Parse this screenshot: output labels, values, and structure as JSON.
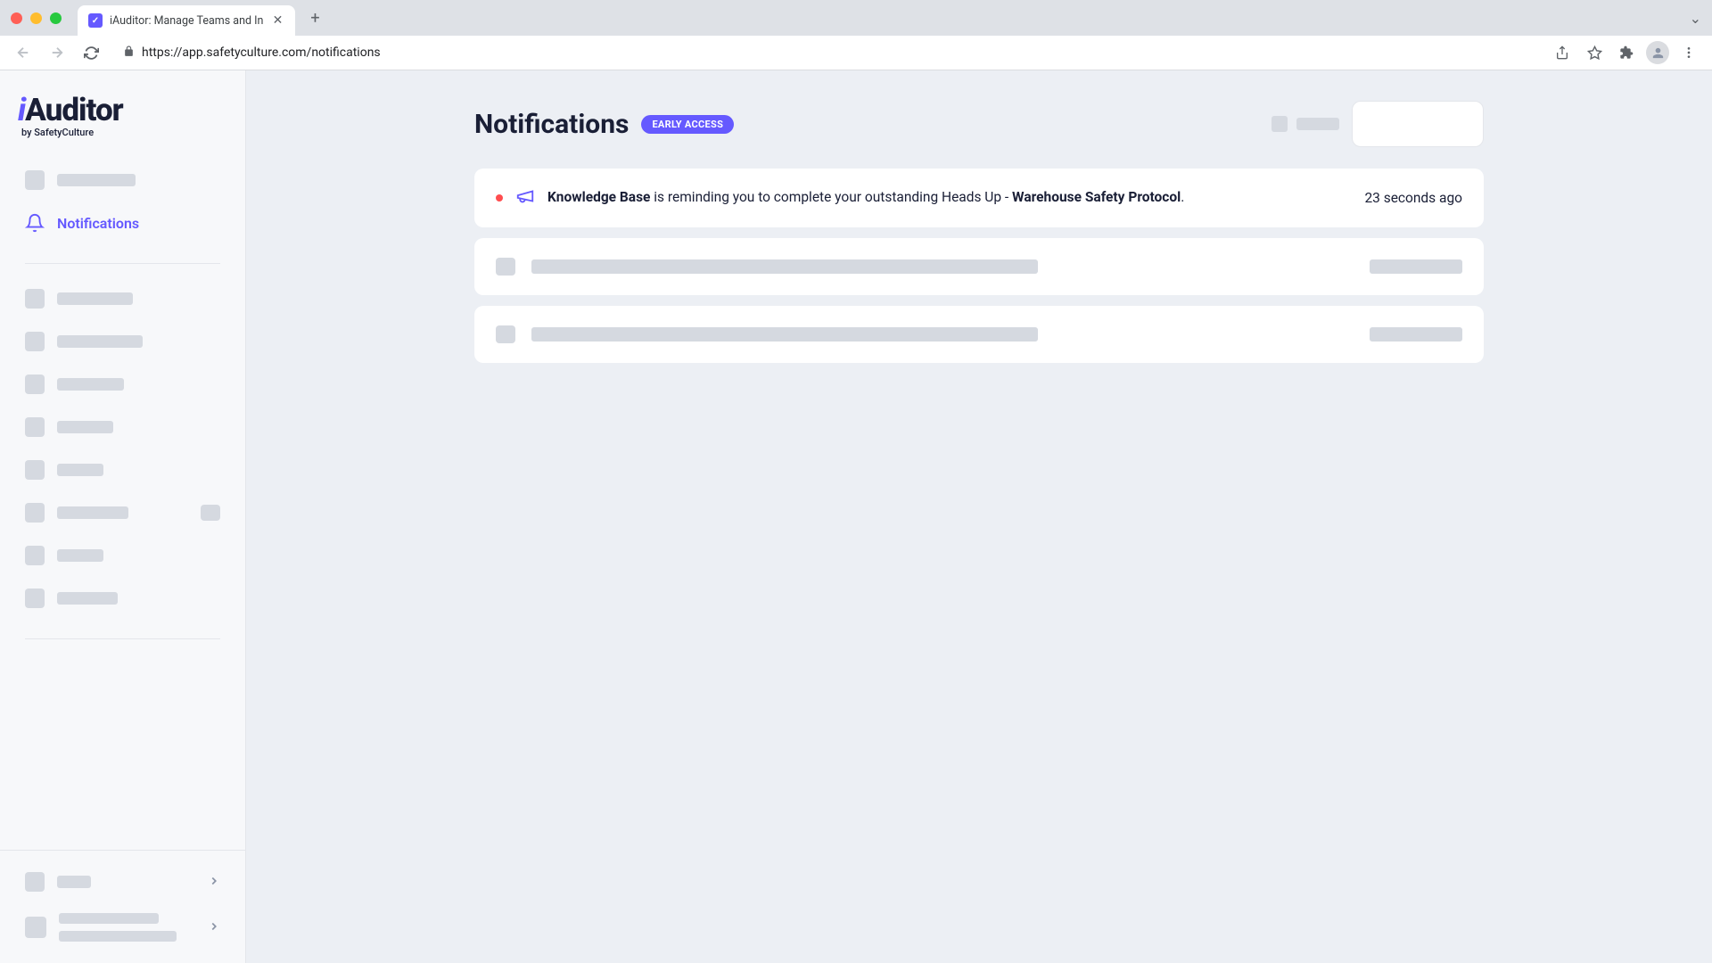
{
  "browser": {
    "tab_title": "iAuditor: Manage Teams and In",
    "url": "https://app.safetyculture.com/notifications"
  },
  "sidebar": {
    "brand_i": "i",
    "brand_rest": "Auditor",
    "brand_sub": "by SafetyCulture",
    "active_label": "Notifications"
  },
  "page": {
    "title": "Notifications",
    "badge": "EARLY ACCESS"
  },
  "notification": {
    "source": "Knowledge Base",
    "middle": " is reminding you to complete your outstanding Heads Up - ",
    "subject": "Warehouse Safety Protocol",
    "suffix": ".",
    "time": "23 seconds ago"
  }
}
